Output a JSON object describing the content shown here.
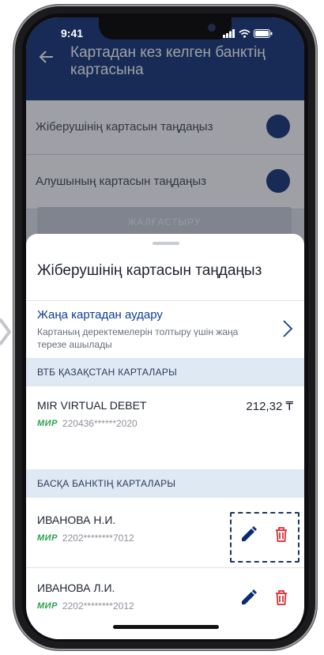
{
  "status_bar": {
    "time": "9:41"
  },
  "background": {
    "header_title": "Картадан кез келген банктің картасына",
    "row1": "Жіберушінің картасын таңдаңыз",
    "row2": "Алушының картасын таңдаңыз",
    "continue_button": "ЖАЛҒАСТЫРУ"
  },
  "sheet": {
    "title": "Жіберушінің картасын таңдаңыз",
    "new_card": {
      "title": "Жаңа картадан аудару",
      "description": "Картаның деректемелерін толтыру үшін жаңа терезе ашылады"
    },
    "sections": [
      {
        "header": "ВТБ ҚАЗАҚСТАН КАРТАЛАРЫ",
        "cards": [
          {
            "name": "MIR VIRTUAL DEBET",
            "brand": "МИР",
            "number": "220436******2020",
            "balance": "212,32 ₸"
          }
        ]
      },
      {
        "header": "БАСҚА БАНКТІҢ КАРТАЛАРЫ",
        "cards": [
          {
            "name": "ИВАНОВА Н.И.",
            "brand": "МИР",
            "number": "2202********7012"
          },
          {
            "name": "ИВАНОВА Л.И.",
            "brand": "МИР",
            "number": "2202********2012"
          }
        ]
      }
    ]
  },
  "colors": {
    "brand_blue": "#0b2a6f",
    "link_blue": "#0b3e96",
    "section_bg": "#dfe9f4",
    "mir_green": "#2aa24b",
    "delete_red": "#d9262c"
  },
  "icons": [
    "back-arrow-icon",
    "chevron-down-icon",
    "chevron-right-icon",
    "edit-pencil-icon",
    "trash-icon"
  ]
}
